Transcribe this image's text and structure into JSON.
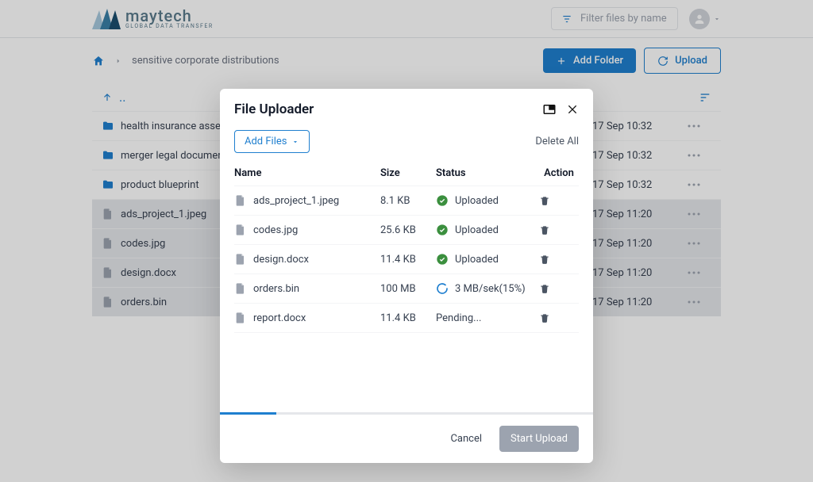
{
  "brand": {
    "name": "maytech",
    "tagline": "GLOBAL DATA TRANSFER"
  },
  "header": {
    "filter_placeholder": "Filter files by name"
  },
  "toolbar": {
    "breadcrumb": "sensitive corporate distributions",
    "add_folder_label": "Add Folder",
    "upload_label": "Upload"
  },
  "list": {
    "up_label": "..",
    "rows": [
      {
        "type": "folder",
        "name": "health insurance assessments",
        "date": "17 Sep 10:32",
        "selected": false
      },
      {
        "type": "folder",
        "name": "merger legal documents",
        "date": "17 Sep 10:32",
        "selected": false
      },
      {
        "type": "folder",
        "name": "product blueprint",
        "date": "17 Sep 10:32",
        "selected": false
      },
      {
        "type": "file",
        "name": "ads_project_1.jpeg",
        "date": "17 Sep 11:20",
        "selected": true
      },
      {
        "type": "file",
        "name": "codes.jpg",
        "date": "17 Sep 11:20",
        "selected": true
      },
      {
        "type": "file",
        "name": "design.docx",
        "date": "17 Sep 11:20",
        "selected": true
      },
      {
        "type": "file",
        "name": "orders.bin",
        "date": "17 Sep 11:20",
        "selected": true
      }
    ]
  },
  "modal": {
    "title": "File Uploader",
    "add_files_label": "Add Files",
    "delete_all_label": "Delete All",
    "columns": {
      "name": "Name",
      "size": "Size",
      "status": "Status",
      "action": "Action"
    },
    "files": [
      {
        "name": "ads_project_1.jpeg",
        "size": "8.1 KB",
        "status_kind": "done",
        "status_text": "Uploaded"
      },
      {
        "name": "codes.jpg",
        "size": "25.6 KB",
        "status_kind": "done",
        "status_text": "Uploaded"
      },
      {
        "name": "design.docx",
        "size": "11.4 KB",
        "status_kind": "done",
        "status_text": "Uploaded"
      },
      {
        "name": "orders.bin",
        "size": "100 MB",
        "status_kind": "progress",
        "status_text": "3 MB/sek(15%)"
      },
      {
        "name": "report.docx",
        "size": "11.4 KB",
        "status_kind": "pending",
        "status_text": "Pending..."
      }
    ],
    "progress_percent": 15,
    "cancel_label": "Cancel",
    "start_label": "Start Upload"
  }
}
